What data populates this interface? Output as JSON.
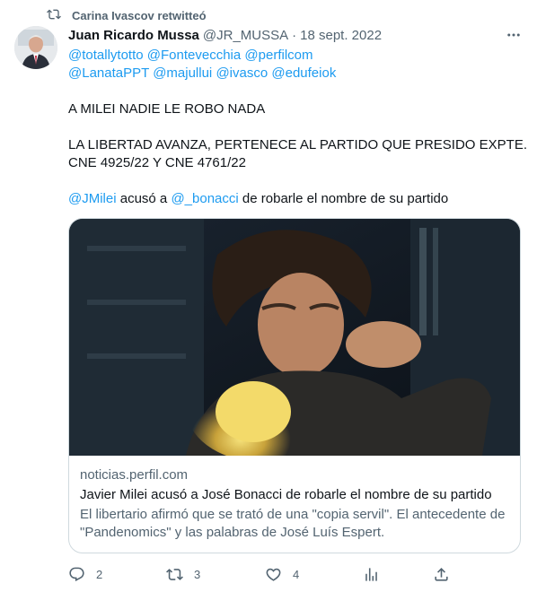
{
  "retweet": {
    "text": "Carina Ivascov retwitteó",
    "icon": "retweet-icon"
  },
  "author": {
    "name": "Juan Ricardo Mussa",
    "handle": "@JR_MUSSA",
    "separator": "·",
    "date": "18 sept. 2022"
  },
  "mentions": {
    "line1": [
      "@totallytotto",
      "@Fontevecchia",
      "@perfilcom"
    ],
    "line2": [
      "@LanataPPT",
      "@majullui",
      "@ivasco",
      "@edufeiok"
    ]
  },
  "body": {
    "p1": "A MILEI NADIE LE ROBO NADA",
    "p2a": "LA LIBERTAD AVANZA, PERTENECE AL PARTIDO QUE PRESIDO EXPTE.",
    "p2b": "CNE 4925/22 Y CNE 4761/22",
    "p3_mention1": "@JMilei",
    "p3_mid": "acusó a",
    "p3_mention2": "@_bonacci",
    "p3_end": "de robarle el nombre de su partido"
  },
  "card": {
    "domain": "noticias.perfil.com",
    "title": "Javier Milei acusó a José Bonacci de robarle el nombre de su partido",
    "description": "El libertario afirmó que se trató de una \"copia servil\". El antecedente de \"Pandenomics\" y las palabras de José Luís Espert."
  },
  "actions": {
    "reply": {
      "icon": "reply-icon",
      "count": "2"
    },
    "retweet": {
      "icon": "retweet-icon",
      "count": "3"
    },
    "like": {
      "icon": "heart-icon",
      "count": "4"
    },
    "analytics": {
      "icon": "analytics-icon"
    },
    "share": {
      "icon": "share-icon"
    }
  },
  "colors": {
    "link": "#1d9bf0",
    "secondary": "#536471",
    "text": "#0f1419",
    "border": "#cfd9de"
  }
}
